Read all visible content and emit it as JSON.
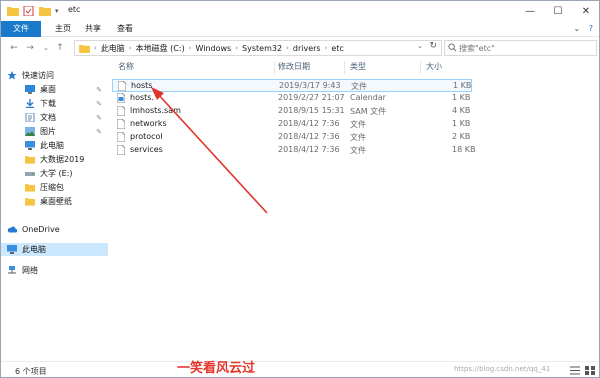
{
  "window": {
    "title": "etc"
  },
  "ribbon": {
    "tabs": [
      "文件",
      "主页",
      "共享",
      "查看"
    ]
  },
  "address": {
    "crumbs": [
      "此电脑",
      "本地磁盘 (C:)",
      "Windows",
      "System32",
      "drivers",
      "etc"
    ]
  },
  "search": {
    "placeholder": "搜索\"etc\""
  },
  "nav": {
    "items": [
      {
        "label": "快速访问",
        "icon": "star-icon"
      },
      {
        "label": "桌面",
        "icon": "desktop-icon",
        "pinned": true
      },
      {
        "label": "下载",
        "icon": "download-icon",
        "pinned": true
      },
      {
        "label": "文档",
        "icon": "document-icon",
        "pinned": true
      },
      {
        "label": "图片",
        "icon": "picture-icon",
        "pinned": true
      },
      {
        "label": "此电脑",
        "icon": "computer-icon"
      },
      {
        "label": "大数据2019",
        "icon": "folder-icon"
      },
      {
        "label": "大学 (E:)",
        "icon": "drive-icon"
      },
      {
        "label": "压缩包",
        "icon": "folder-icon"
      },
      {
        "label": "桌面壁纸",
        "icon": "folder-icon"
      },
      {
        "label": "OneDrive",
        "icon": "cloud-icon"
      },
      {
        "label": "此电脑",
        "icon": "computer-icon",
        "selected": true
      },
      {
        "label": "网络",
        "icon": "network-icon"
      }
    ]
  },
  "list": {
    "columns": [
      "名称",
      "修改日期",
      "类型",
      "大小"
    ],
    "rows": [
      {
        "name": "hosts",
        "date": "2019/3/17 9:43",
        "type": "文件",
        "size": "1 KB",
        "selected": true
      },
      {
        "name": "hosts.",
        "date": "2019/2/27 21:07",
        "type": "Calendar",
        "size": "1 KB"
      },
      {
        "name": "lmhosts.sam",
        "date": "2018/9/15 15:31",
        "type": "SAM 文件",
        "size": "4 KB"
      },
      {
        "name": "networks",
        "date": "2018/4/12 7:36",
        "type": "文件",
        "size": "1 KB"
      },
      {
        "name": "protocol",
        "date": "2018/4/12 7:36",
        "type": "文件",
        "size": "2 KB"
      },
      {
        "name": "services",
        "date": "2018/4/12 7:36",
        "type": "文件",
        "size": "18 KB"
      }
    ]
  },
  "status": {
    "count": "6 个项目"
  },
  "watermark": {
    "text": "一笑看风云过",
    "url": "https://blog.csdn.net/qq_41"
  },
  "colors": {
    "accent": "#1979ca",
    "selection": "#cce8ff",
    "arrow": "#e2352b"
  }
}
